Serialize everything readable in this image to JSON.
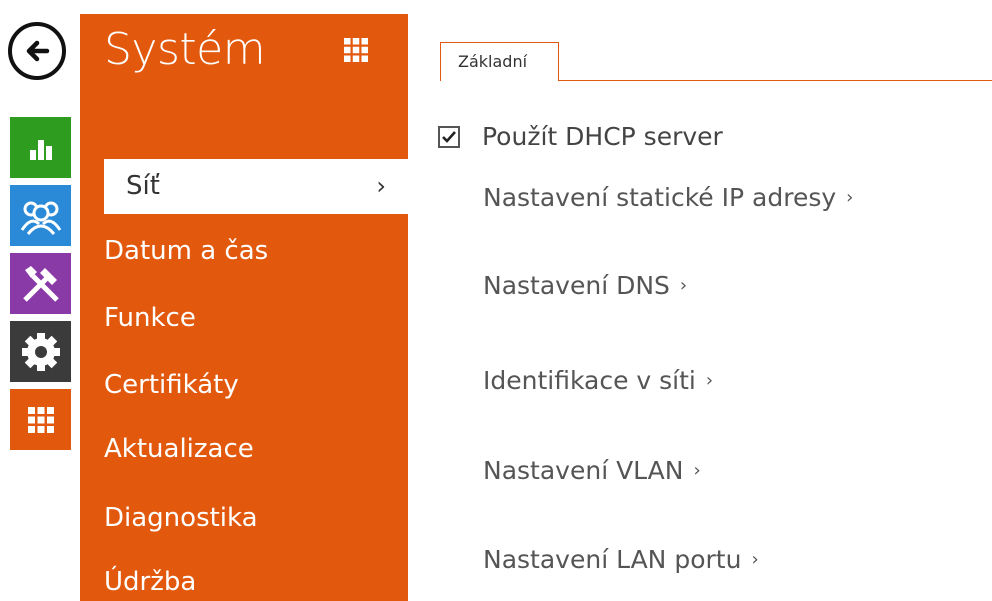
{
  "rail": {
    "back_icon": "arrow-left-icon",
    "tiles": [
      {
        "icon": "bar-chart-icon",
        "color": "#2e9c1e"
      },
      {
        "icon": "users-icon",
        "color": "#2a8ad8"
      },
      {
        "icon": "tools-icon",
        "color": "#8a3aa6"
      },
      {
        "icon": "gear-icon",
        "color": "#3b3b3b"
      },
      {
        "icon": "grid-icon",
        "color": "#e2590d"
      }
    ]
  },
  "menu": {
    "title": "Systém",
    "grid_icon": "grid-icon",
    "items": [
      {
        "label": "Síť",
        "active": true
      },
      {
        "label": "Datum a čas"
      },
      {
        "label": "Funkce"
      },
      {
        "label": "Certifikáty"
      },
      {
        "label": "Aktualizace"
      },
      {
        "label": "Diagnostika"
      },
      {
        "label": "Údržba"
      }
    ],
    "active_chevron": "›"
  },
  "content": {
    "tab_label": "Základní",
    "dhcp_label": "Použít DHCP server",
    "dhcp_checked": true,
    "links": [
      "Nastavení statické IP adresy",
      "Nastavení DNS",
      "Identifikace v síti",
      "Nastavení VLAN",
      "Nastavení LAN portu"
    ],
    "link_chevron": "›"
  },
  "colors": {
    "accent": "#e2590d"
  }
}
